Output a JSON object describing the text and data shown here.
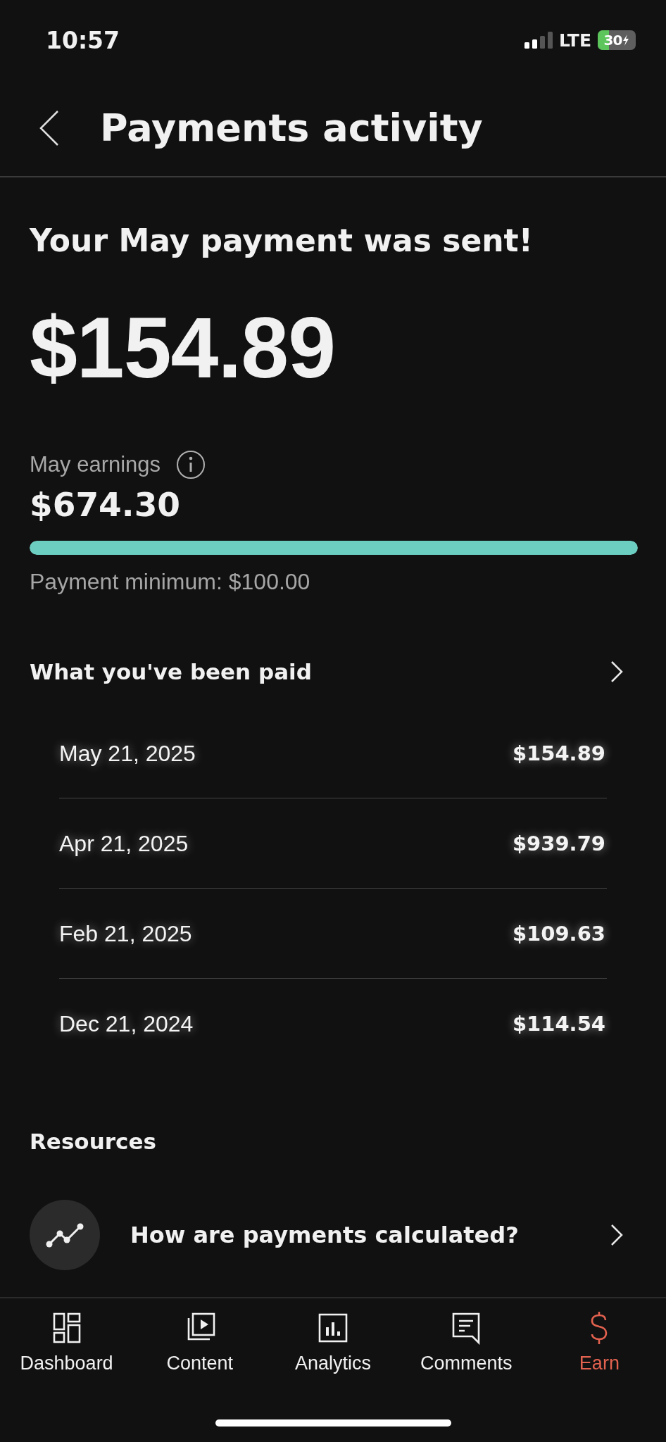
{
  "status_bar": {
    "time": "10:57",
    "network": "LTE",
    "battery": "30"
  },
  "header": {
    "title": "Payments activity"
  },
  "payment": {
    "headline": "Your May payment was sent!",
    "amount": "$154.89"
  },
  "earnings": {
    "label": "May earnings",
    "amount": "$674.30",
    "level": 1,
    "minimum": "Payment minimum: $100.00"
  },
  "history": {
    "title": "What you've been paid",
    "rows": [
      {
        "date": "May 21, 2025",
        "amount": "$154.89"
      },
      {
        "date": "Apr 21, 2025",
        "amount": "$939.79"
      },
      {
        "date": "Feb 21, 2025",
        "amount": "$109.63"
      },
      {
        "date": "Dec 21, 2024",
        "amount": "$114.54"
      }
    ]
  },
  "resources": {
    "title": "Resources",
    "items": [
      {
        "label": "How are payments calculated?"
      }
    ]
  },
  "tab_bar": {
    "tabs": [
      {
        "label": "Dashboard",
        "selected": false
      },
      {
        "label": "Content",
        "selected": false
      },
      {
        "label": "Analytics",
        "selected": false
      },
      {
        "label": "Comments",
        "selected": false
      },
      {
        "label": "Earn",
        "selected": true
      }
    ]
  }
}
